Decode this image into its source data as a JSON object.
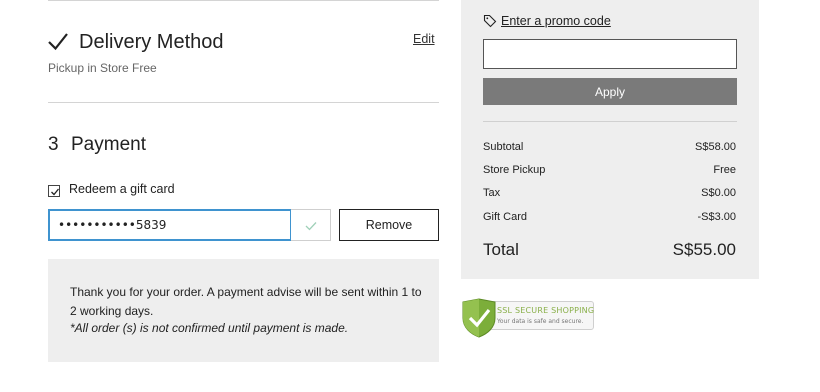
{
  "delivery": {
    "title": "Delivery Method",
    "edit_label": "Edit",
    "subtitle": "Pickup in Store Free"
  },
  "payment": {
    "step_number": "3",
    "title": "Payment",
    "gift_card": {
      "checkbox_label": "Redeem a gift card",
      "checked": true,
      "masked_value": "•••••••••••5839",
      "remove_label": "Remove"
    },
    "notice": {
      "text": "Thank you for your order. A payment advise will be sent within 1 to 2 working days.",
      "note": "*All order (s) is not confirmed until payment is made."
    }
  },
  "summary": {
    "promo_link": "Enter a promo code",
    "promo_value": "",
    "apply_label": "Apply",
    "rows": [
      {
        "label": "Subtotal",
        "value": "S$58.00"
      },
      {
        "label": "Store Pickup",
        "value": "Free"
      },
      {
        "label": "Tax",
        "value": "S$0.00"
      },
      {
        "label": "Gift Card",
        "value": "-S$3.00"
      }
    ],
    "total_label": "Total",
    "total_value": "S$55.00"
  },
  "ssl_badge": {
    "title": "SSL SECURE SHOPPING",
    "subtitle": "Your data is safe and secure.",
    "icon": "shield-check-icon"
  },
  "colors": {
    "input_focus": "#3f93cf",
    "apply_button": "#7a7a7a",
    "panel_bg": "#eeeeee",
    "ssl_green": "#8ab04a"
  }
}
